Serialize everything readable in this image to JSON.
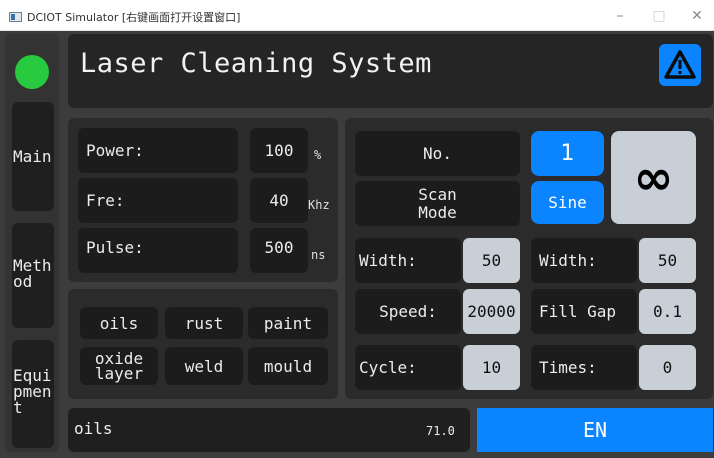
{
  "window": {
    "title": "DCIOT Simulator [右键画面打开设置窗口]",
    "minimize_glyph": "–",
    "maximize_glyph": "□",
    "close_glyph": "✕"
  },
  "header": {
    "title": "Laser Cleaning System",
    "status_color": "#27c93f",
    "alert_icon": "warning-triangle-icon"
  },
  "sidebar": {
    "items": [
      {
        "label": "Main"
      },
      {
        "label": "Meth od"
      },
      {
        "label": "Equi pmen t"
      }
    ]
  },
  "params": {
    "power": {
      "label": "Power:",
      "value": "100",
      "unit": "%"
    },
    "fre": {
      "label": "Fre:",
      "value": "40",
      "unit": "Khz"
    },
    "pulse": {
      "label": "Pulse:",
      "value": "500",
      "unit": "ns"
    }
  },
  "materials": {
    "oils": "oils",
    "rust": "rust",
    "paint": "paint",
    "oxide": "oxide layer",
    "weld": "weld",
    "mould": "mould"
  },
  "scan": {
    "no_label": "No.",
    "no_value": "1",
    "infinity_glyph": "∞",
    "scan_mode_label": "Scan Mode",
    "scan_mode_value": "Sine",
    "width_label": "Width:",
    "width_value": "50",
    "width2_label": "Width:",
    "width2_value": "50",
    "speed_label": "Speed:",
    "speed_value": "20000",
    "fillgap_label": "Fill Gap",
    "fillgap_value": "0.1",
    "cycle_label": "Cycle:",
    "cycle_value": "10",
    "times_label": "Times:",
    "times_value": "0"
  },
  "status": {
    "material": "oils",
    "value": "71.0",
    "lang_button": "EN"
  },
  "colors": {
    "accent": "#0a84ff",
    "background": "#3c3c3c",
    "panel": "#2b2b2b",
    "cell": "#1c1c1c",
    "value_box": "#c9cfd6"
  }
}
